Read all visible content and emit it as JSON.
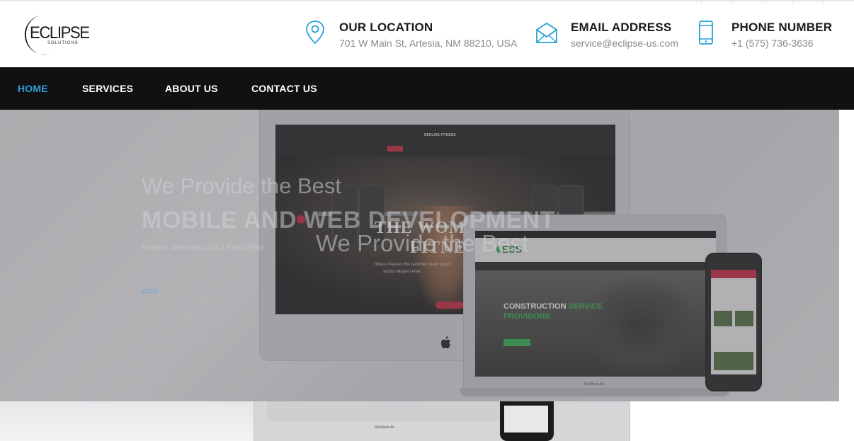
{
  "brand": {
    "name": "ECLIPSE",
    "tagline": "SOLUTIONS"
  },
  "contact": [
    {
      "icon": "map-pin-icon",
      "label": "OUR LOCATION",
      "value": "701 W Main St, Artesia, NM 88210, USA"
    },
    {
      "icon": "envelope-icon",
      "label": "EMAIL ADDRESS",
      "value": "service@eclipse-us.com"
    },
    {
      "icon": "phone-icon",
      "label": "PHONE NUMBER",
      "value": "+1 (575) 736-3636"
    }
  ],
  "nav": {
    "items": [
      {
        "label": "HOME",
        "active": true
      },
      {
        "label": "SERVICES",
        "active": false
      },
      {
        "label": "ABOUT US",
        "active": false
      },
      {
        "label": "CONTACT US",
        "active": false
      }
    ]
  },
  "hero": {
    "line1": "We Provide the Best",
    "line2": "MOBILE AND WEB DEVELOPMENT",
    "line3": "Modern Websites with a Fresh Feel.",
    "overlap": "We Provide the Best",
    "imac_site": {
      "brand": "REDLINE FITNESS",
      "headline_1": "THE WOMEN",
      "headline_2": "FITNE",
      "body": "fitness classes this summer lorem ipsum",
      "body2": "auctor aliquet cenec"
    },
    "laptop_site": {
      "logo": "ESS",
      "headline_white": "CONSTRUCTION",
      "headline_green_1": "SERVICE",
      "headline_green_2": "PROVIDORS",
      "label": "MacBook Air"
    }
  },
  "colors": {
    "accent": "#2a9fd6",
    "nav_bg": "#111111",
    "icon_blue": "#2a9fd6"
  }
}
